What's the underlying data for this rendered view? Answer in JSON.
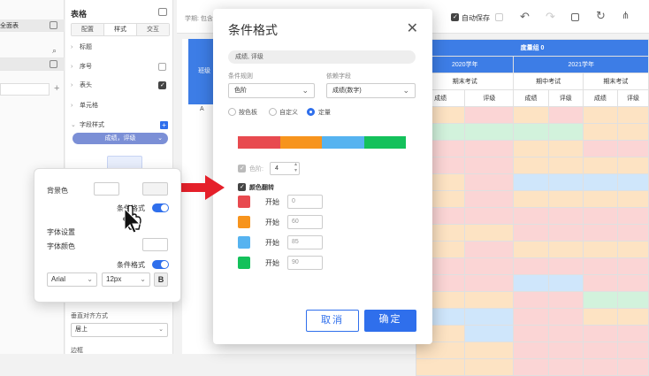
{
  "colors": {
    "accent": "#2f6fec",
    "red": "#e84a4f",
    "orange": "#f7941d",
    "lightblue": "#56b3f0",
    "green": "#14c15b",
    "header_blue": "#3d7de6"
  },
  "leftbar": {
    "item1": "全面表"
  },
  "props": {
    "title": "表格",
    "tabs": [
      "配置",
      "样式",
      "交互"
    ],
    "rows": [
      {
        "label": "标题"
      },
      {
        "label": "序号"
      },
      {
        "label": "表头"
      },
      {
        "label": "单元格"
      },
      {
        "label": "字段样式"
      }
    ],
    "field_pill": "成绩，评级",
    "vertical_align_label": "垂直对齐方式",
    "vertical_align_value": "居上",
    "border_label": "边框"
  },
  "floatpanel": {
    "bg_color_label": "背景色",
    "cond_format_1": "条件格式",
    "font_settings": "字体设置",
    "font_color_label": "字体颜色",
    "cond_format_2": "条件格式",
    "font_family": "Arial",
    "font_size": "12px",
    "bold": "B"
  },
  "toolbar": {
    "breadcrumb": "学期: 包含",
    "autosave": "自动保存"
  },
  "dialog": {
    "title": "条件格式",
    "field_tag": "成绩, 评级",
    "rule_label": "条件规则",
    "rule_value": "色阶",
    "depend_label": "依赖字段",
    "depend_value": "成绩(数字)",
    "radio_options": [
      "按色板",
      "自定义",
      "定量"
    ],
    "radio_selected": 2,
    "steps_label": "色阶:",
    "steps_value": "4",
    "reverse_label": "颜色翻转",
    "start_label": "开始",
    "start_rows": [
      {
        "color": "#e84a4f",
        "value": "0"
      },
      {
        "color": "#f7941d",
        "value": "60"
      },
      {
        "color": "#56b3f0",
        "value": "85"
      },
      {
        "color": "#14c15b",
        "value": "90"
      }
    ],
    "cancel": "取消",
    "confirm": "确定"
  },
  "table": {
    "group": "度量组 0",
    "left_header": "班级",
    "year1": "2020学年",
    "year2": "2021学年",
    "term1": "期末考试",
    "term2": "期中考试",
    "term3": "期末考试",
    "cols": [
      "成绩",
      "评级",
      "成绩",
      "评级",
      "成绩",
      "评级"
    ],
    "left_cell": "A"
  }
}
